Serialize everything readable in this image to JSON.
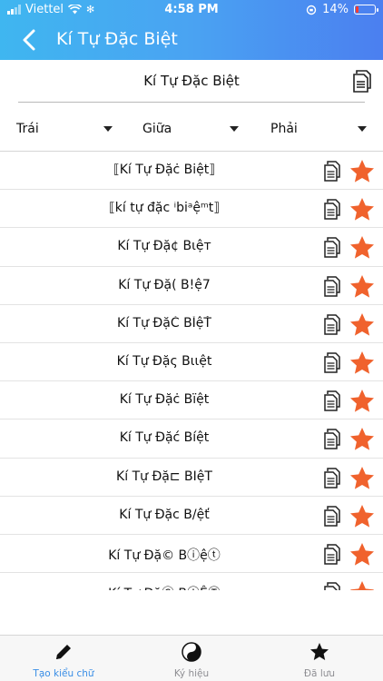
{
  "status_bar": {
    "carrier": "Viettel",
    "time": "4:58 PM",
    "battery": "14%",
    "battery_level": 0.14
  },
  "header": {
    "title": "Kí Tự Đặc Biệt",
    "back_icon": "chevron-left-icon"
  },
  "input": {
    "value": "Kí Tự Đặc Biệt",
    "copy_icon": "copy-document-icon"
  },
  "selectors": [
    {
      "label": "Trái"
    },
    {
      "label": "Giữa"
    },
    {
      "label": "Phải"
    }
  ],
  "results": [
    {
      "text": "⟦Kí Tự Đặċ Biệṫ⟧"
    },
    {
      "text": "⟦kí tự đặc ⁱbiᵃệᵐt⟧"
    },
    {
      "text": "Kí Tự Đặ¢ Bιệт"
    },
    {
      "text": "Kí Tự Đặ( B!ệ7"
    },
    {
      "text": "Kí Tự ĐặČ BĬệŤ"
    },
    {
      "text": "Kí Tự Đặς Bιιệt"
    },
    {
      "text": "Kí Tự Đặċ Bïệt"
    },
    {
      "text": "Kí Tự Đặć Bíệt"
    },
    {
      "text": "Kí Tự Đặ⊏ BIệT"
    },
    {
      "text": "Kí Tự Đặc B/ệť"
    },
    {
      "text": "Kí Tự Đặ© Bⓘệⓣ"
    },
    {
      "text": "Kí Tự ĐặⒸ BⒾỆⓉ"
    }
  ],
  "tabs": [
    {
      "label": "Tạo kiểu chữ",
      "icon": "pencil-icon",
      "active": true
    },
    {
      "label": "Ký hiệu",
      "icon": "yin-yang-icon",
      "active": false
    },
    {
      "label": "Đã lưu",
      "icon": "star-icon",
      "active": false
    }
  ],
  "colors": {
    "header_gradient_start": "#3fb6f0",
    "header_gradient_end": "#4b7ff0",
    "star": "#f0622d",
    "tab_active": "#3a8ee6",
    "tab_inactive": "#8e8e93"
  }
}
